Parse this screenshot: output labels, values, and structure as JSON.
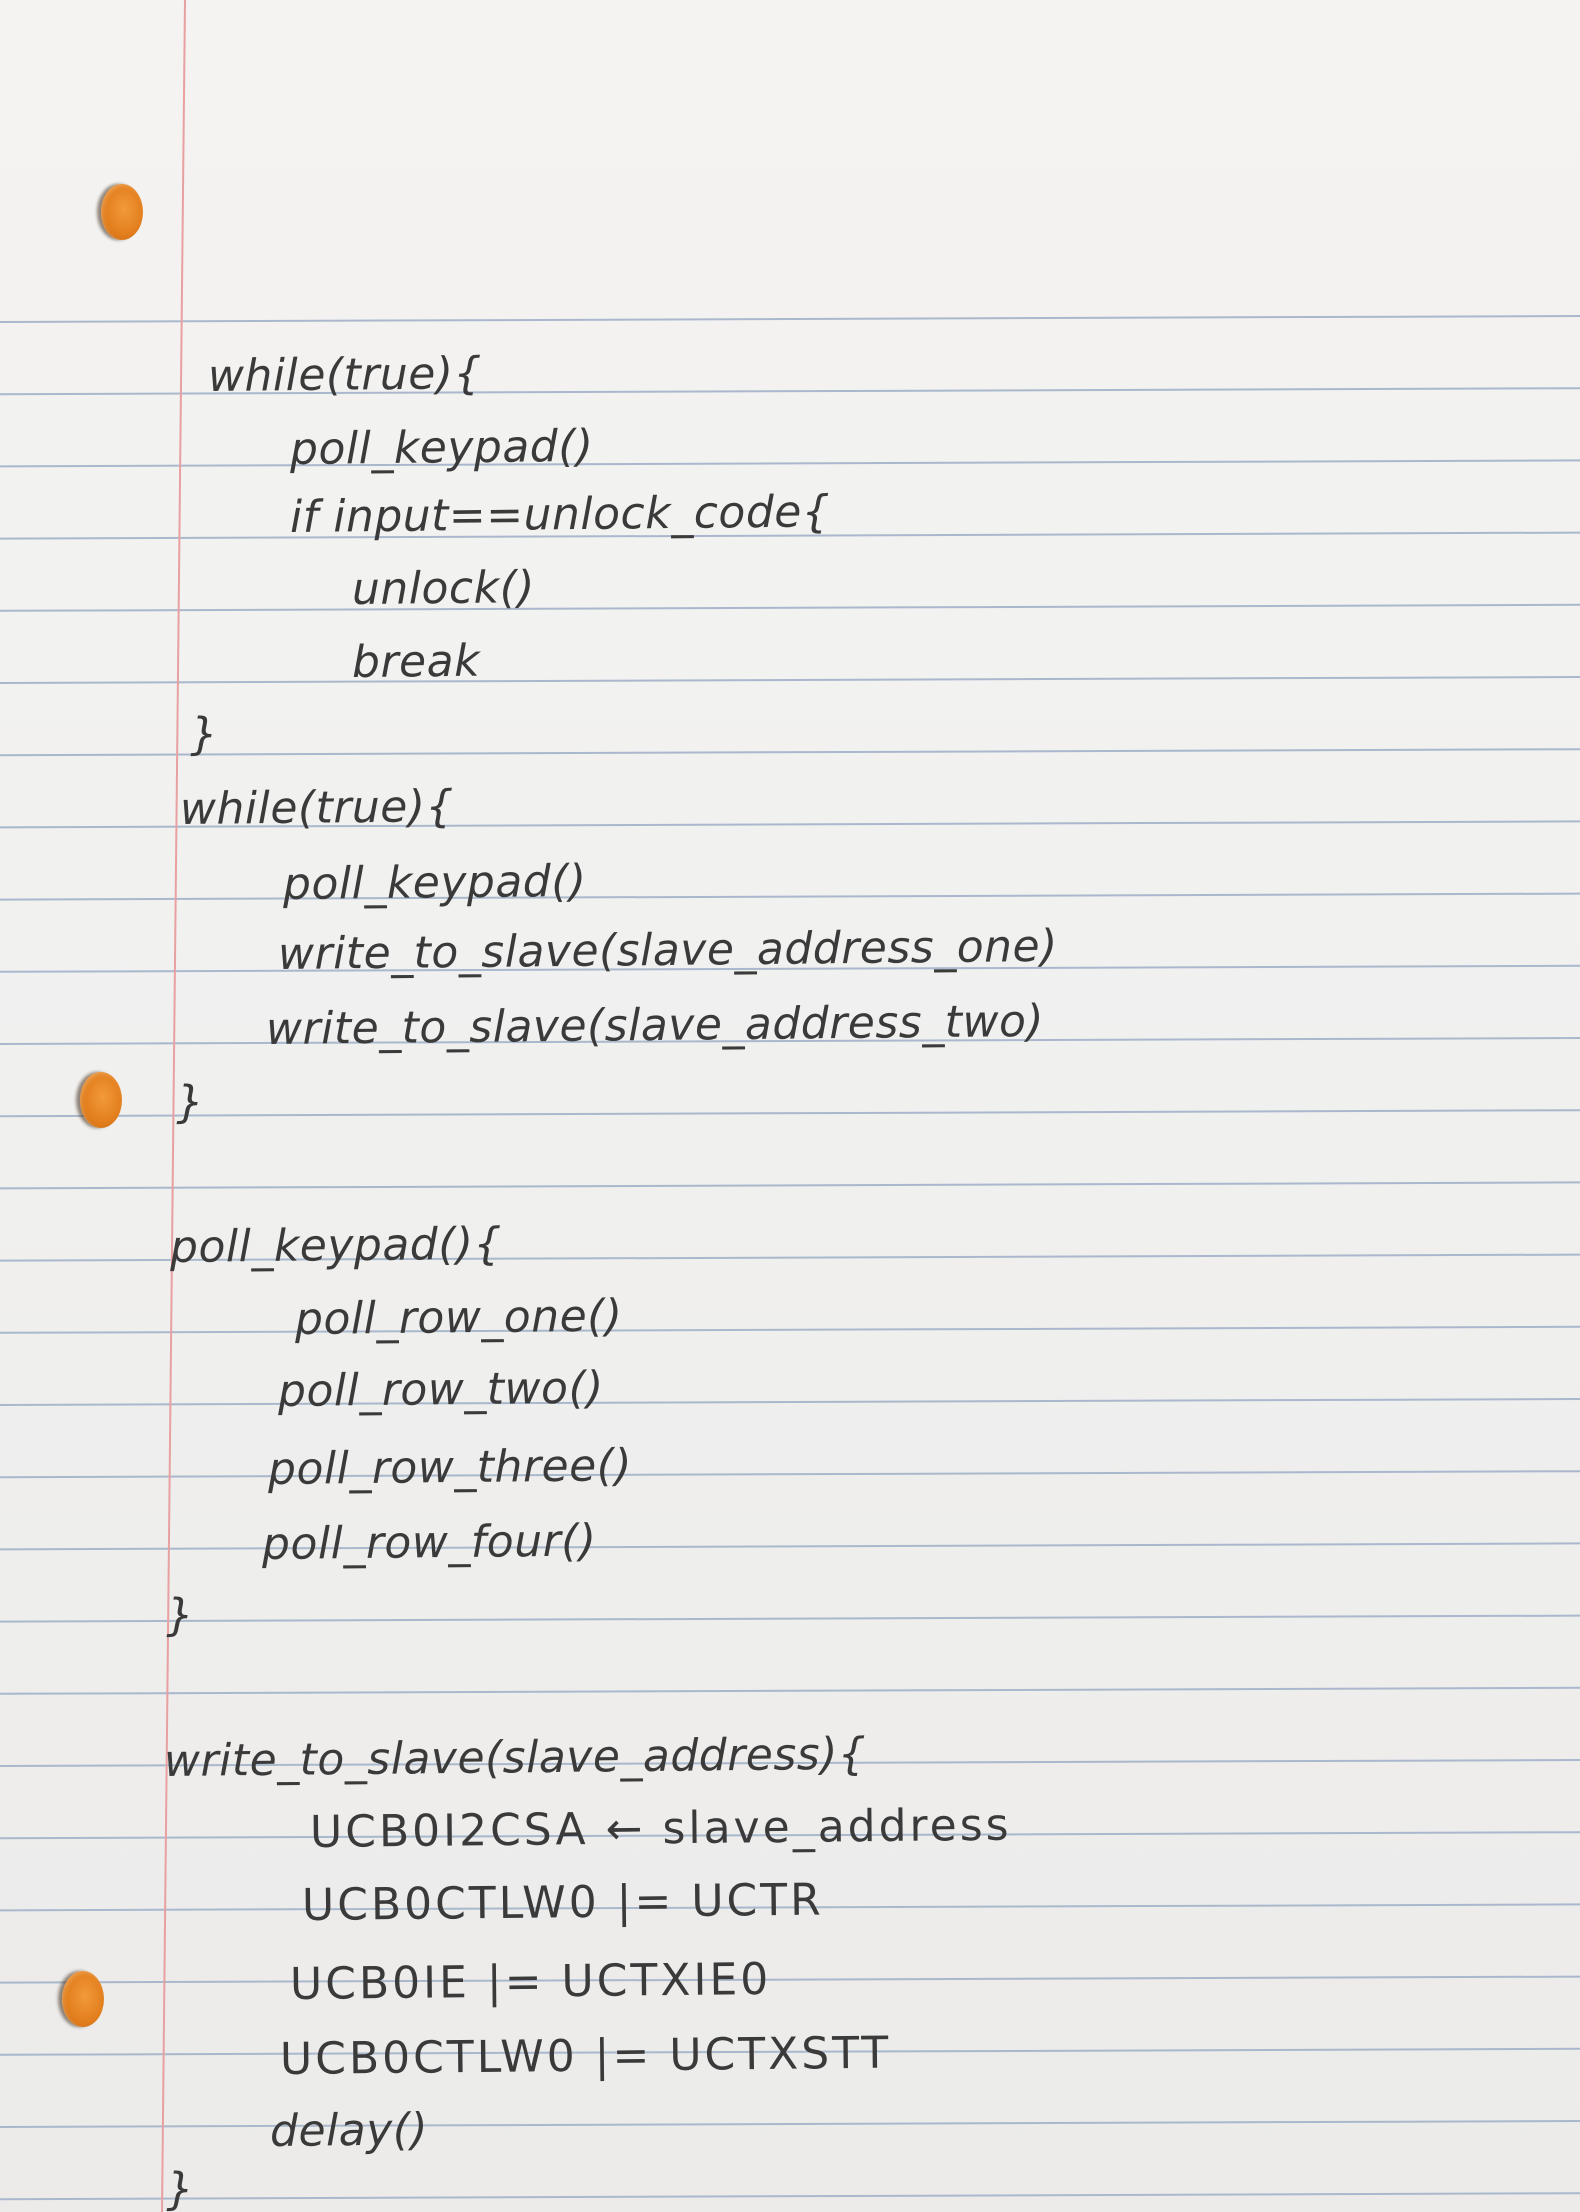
{
  "colors": {
    "paper": "#f3f2f0",
    "rule_line": "#a9b8cc",
    "margin_line": "#e8a0a0",
    "ink": "#3b3a3a",
    "punch_hole": "#e8841f"
  },
  "lines": [
    "while(true){",
    "poll_keypad()",
    "if input==unlock_code{",
    "unlock()",
    "break",
    "}",
    "while(true){",
    "poll_keypad()",
    "write_to_slave(slave_address_one)",
    "write_to_slave(slave_address_two)",
    "}",
    "poll_keypad(){",
    "poll_row_one()",
    "poll_row_two()",
    "poll_row_three()",
    "poll_row_four()",
    "}",
    "write_to_slave(slave_address){",
    "UCB0I2CSA ← slave_address",
    "UCB0CTLW0 |= UCTR",
    "UCB0IE |= UCTXIE0",
    "UCB0CTLW0 |= UCTXSTT",
    "delay()",
    "}"
  ]
}
